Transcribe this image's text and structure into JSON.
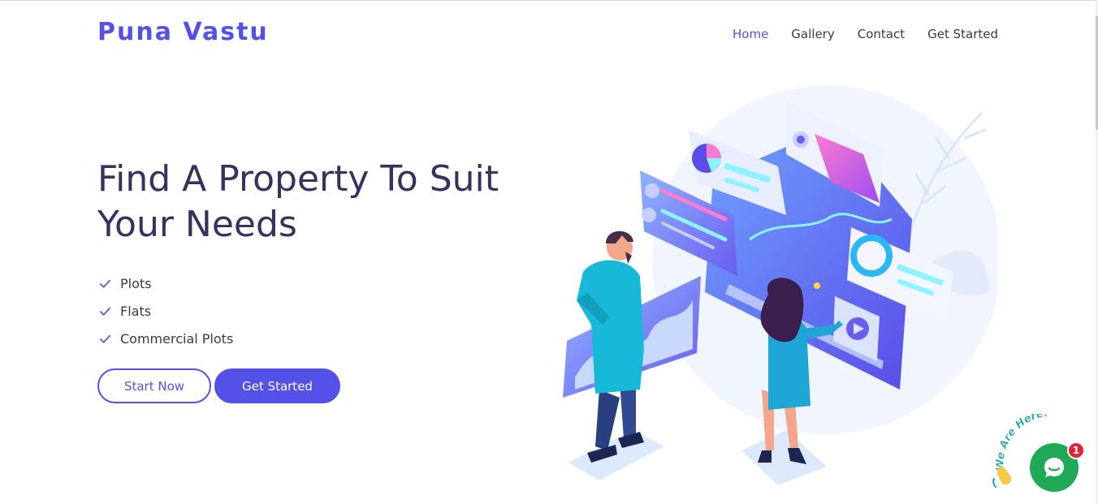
{
  "header": {
    "logo": "Puna Vastu",
    "nav": [
      {
        "label": "Home",
        "active": true
      },
      {
        "label": "Gallery",
        "active": false
      },
      {
        "label": "Contact",
        "active": false
      },
      {
        "label": "Get Started",
        "active": false
      }
    ]
  },
  "hero": {
    "title_line1": "Find A Property To Suit",
    "title_line2": "Your Needs",
    "features": [
      "Plots",
      "Flats",
      "Commercial Plots"
    ],
    "buttons": {
      "start_now": "Start Now",
      "get_started": "Get Started"
    },
    "illustration_icon": "people-with-dashboard-illustration"
  },
  "chat": {
    "tagline": "We Are Here!",
    "badge_count": "1",
    "icon": "chat-bubble-icon"
  },
  "colors": {
    "accent": "#5451e8",
    "title": "#36325f",
    "chat_green": "#1fa855",
    "badge_red": "#e0223c"
  }
}
